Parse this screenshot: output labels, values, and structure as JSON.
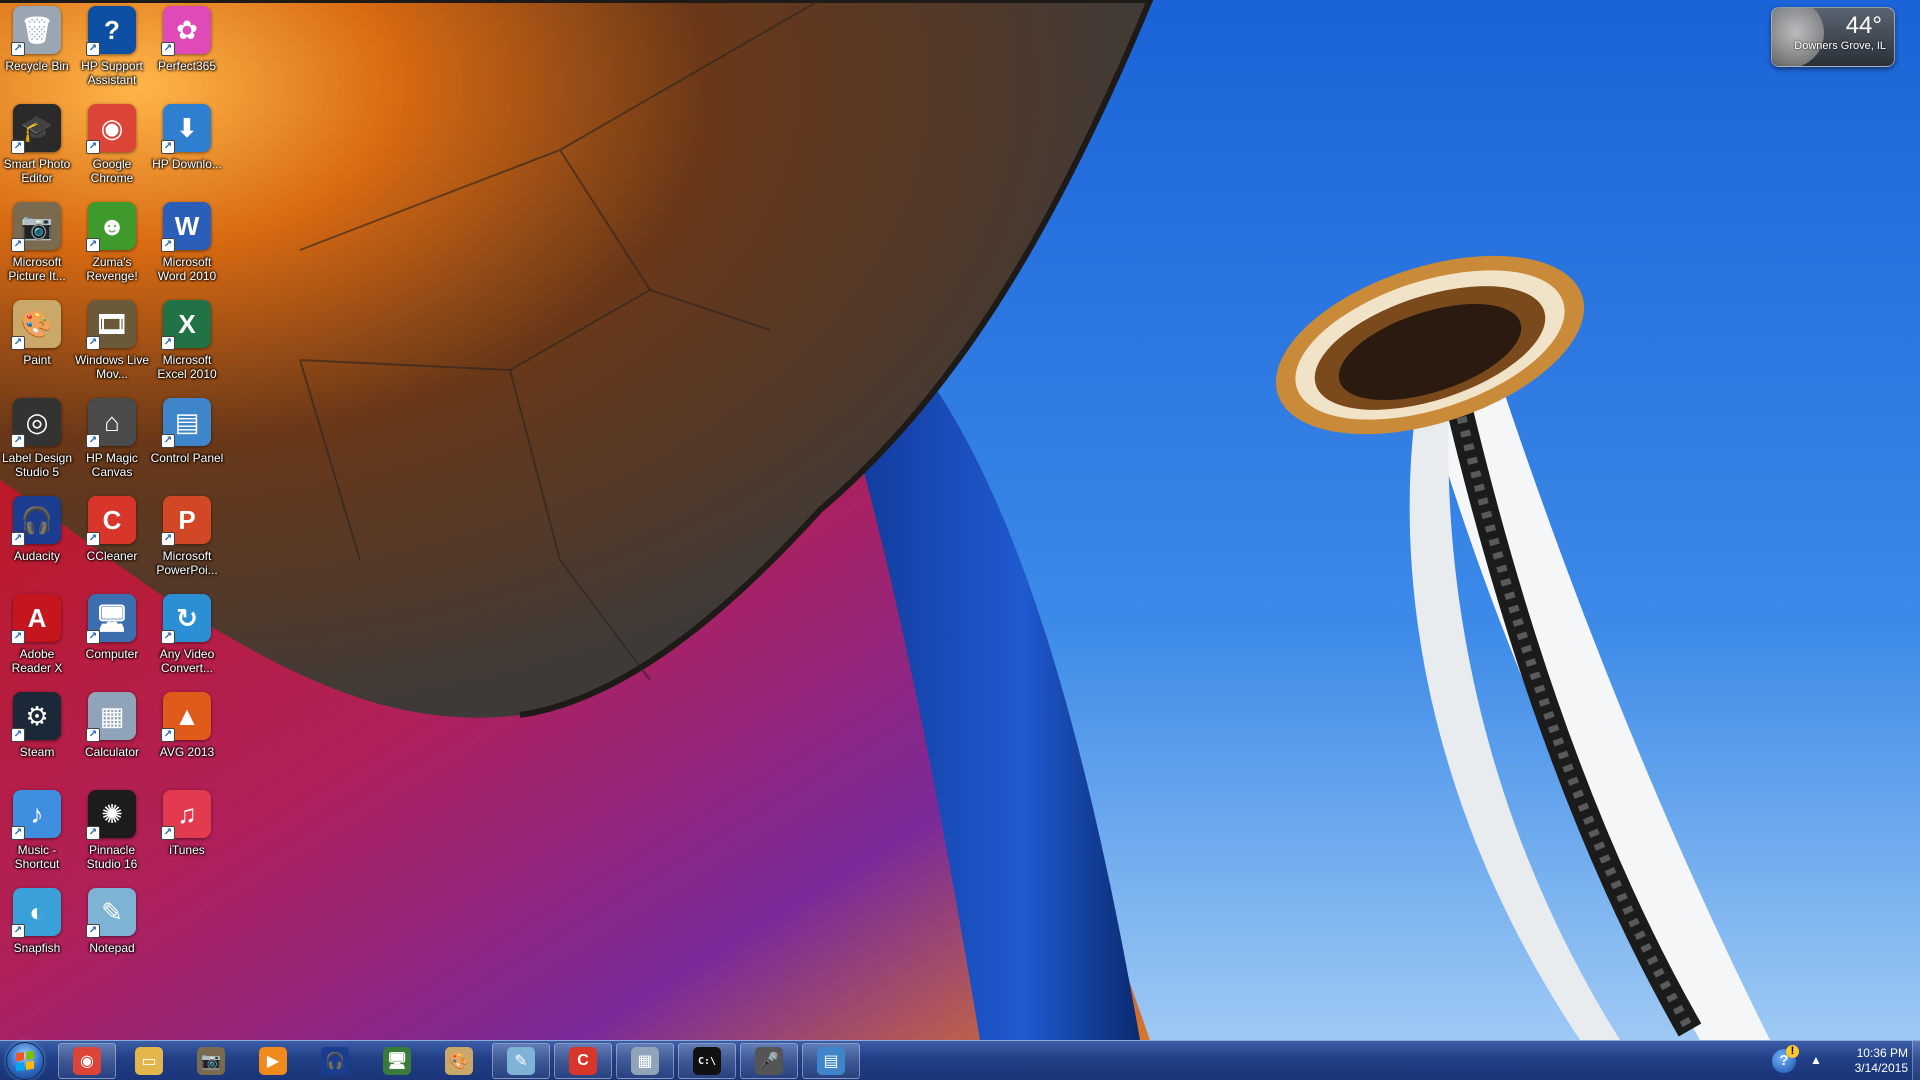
{
  "desktop": {
    "icons": [
      {
        "label": "Recycle Bin",
        "icon": "recycle-bin-icon",
        "glyph": "🗑",
        "color": "#9aa7b2"
      },
      {
        "label": "HP Support Assistant",
        "icon": "hp-support-icon",
        "glyph": "?",
        "color": "#0d4fa3"
      },
      {
        "label": "Perfect365",
        "icon": "perfect365-icon",
        "glyph": "✿",
        "color": "#e04ab8"
      },
      {
        "label": "Smart Photo Editor",
        "icon": "graduation-cap-icon",
        "glyph": "🎓",
        "color": "#2a2a2a"
      },
      {
        "label": "Google Chrome",
        "icon": "chrome-icon",
        "glyph": "◉",
        "color": "#db4437"
      },
      {
        "label": "HP Downlo...",
        "icon": "hp-download-icon",
        "glyph": "⬇",
        "color": "#2f7fd1"
      },
      {
        "label": "Microsoft Picture It...",
        "icon": "camera-icon",
        "glyph": "📷",
        "color": "#7a6a50"
      },
      {
        "label": "Zuma's Revenge!",
        "icon": "zuma-frog-icon",
        "glyph": "☻",
        "color": "#3f9a2c"
      },
      {
        "label": "Microsoft Word 2010",
        "icon": "word-icon",
        "glyph": "W",
        "color": "#2b5eb8"
      },
      {
        "label": "Paint",
        "icon": "paint-palette-icon",
        "glyph": "🎨",
        "color": "#c9a86a"
      },
      {
        "label": "Windows Live Mov...",
        "icon": "movie-maker-icon",
        "glyph": "🎞",
        "color": "#6b5a3a"
      },
      {
        "label": "Microsoft Excel 2010",
        "icon": "excel-icon",
        "glyph": "X",
        "color": "#217346"
      },
      {
        "label": "Label Design Studio 5",
        "icon": "disc-icon",
        "glyph": "◎",
        "color": "#333333"
      },
      {
        "label": "HP Magic Canvas",
        "icon": "house-icon",
        "glyph": "⌂",
        "color": "#4b4b4b"
      },
      {
        "label": "Control Panel",
        "icon": "control-panel-icon",
        "glyph": "▤",
        "color": "#3e86c9"
      },
      {
        "label": "Audacity",
        "icon": "audacity-icon",
        "glyph": "🎧",
        "color": "#1b3d8f"
      },
      {
        "label": "CCleaner",
        "icon": "ccleaner-icon",
        "glyph": "C",
        "color": "#d8362a"
      },
      {
        "label": "Microsoft PowerPoi...",
        "icon": "powerpoint-icon",
        "glyph": "P",
        "color": "#d24726"
      },
      {
        "label": "Adobe Reader X",
        "icon": "adobe-reader-icon",
        "glyph": "A",
        "color": "#c4161c"
      },
      {
        "label": "Computer",
        "icon": "computer-icon",
        "glyph": "🖥",
        "color": "#3d6fb0"
      },
      {
        "label": "Any Video Convert...",
        "icon": "video-converter-icon",
        "glyph": "↻",
        "color": "#2b8fd6"
      },
      {
        "label": "Steam",
        "icon": "steam-icon",
        "glyph": "⚙",
        "color": "#1b2838"
      },
      {
        "label": "Calculator",
        "icon": "calculator-icon",
        "glyph": "▦",
        "color": "#8fa4b8"
      },
      {
        "label": "AVG 2013",
        "icon": "avg-icon",
        "glyph": "▲",
        "color": "#e05a1a"
      },
      {
        "label": "Music - Shortcut",
        "icon": "music-note-icon",
        "glyph": "♪",
        "color": "#3f8fe0"
      },
      {
        "label": "Pinnacle Studio 16",
        "icon": "pinnacle-icon",
        "glyph": "✺",
        "color": "#1c1c1c"
      },
      {
        "label": "iTunes",
        "icon": "itunes-icon",
        "glyph": "♫",
        "color": "#e23a4f"
      },
      {
        "label": "Snapfish",
        "icon": "snapfish-icon",
        "glyph": "◐",
        "color": "#3aa0d8"
      },
      {
        "label": "Notepad",
        "icon": "notepad-icon",
        "glyph": "✎",
        "color": "#7fb3d5"
      }
    ]
  },
  "weather": {
    "temperature": "44°",
    "location": "Downers Grove, IL"
  },
  "taskbar": {
    "items": [
      {
        "name": "chrome",
        "icon": "chrome-icon",
        "glyph": "◉",
        "color": "#db4437",
        "open": true
      },
      {
        "name": "explorer",
        "icon": "folder-icon",
        "glyph": "▭",
        "color": "#e3b64b",
        "open": false
      },
      {
        "name": "picture-it",
        "icon": "camera-icon",
        "glyph": "📷",
        "color": "#7a6a50",
        "open": false
      },
      {
        "name": "media-player",
        "icon": "play-icon",
        "glyph": "▶",
        "color": "#f08a1c",
        "open": false
      },
      {
        "name": "audacity",
        "icon": "audacity-icon",
        "glyph": "🎧",
        "color": "#1b3d8f",
        "open": false
      },
      {
        "name": "system-monitor",
        "icon": "monitor-icon",
        "glyph": "🖥",
        "color": "#3a7a3a",
        "open": false
      },
      {
        "name": "paint",
        "icon": "paint-palette-icon",
        "glyph": "🎨",
        "color": "#c9a86a",
        "open": false
      },
      {
        "name": "notepad",
        "icon": "notepad-icon",
        "glyph": "✎",
        "color": "#7fb3d5",
        "open": true
      },
      {
        "name": "ccleaner",
        "icon": "ccleaner-icon",
        "glyph": "C",
        "color": "#d8362a",
        "open": true
      },
      {
        "name": "calculator",
        "icon": "calculator-icon",
        "glyph": "▦",
        "color": "#8fa4b8",
        "open": true
      },
      {
        "name": "command-prompt",
        "icon": "terminal-icon",
        "glyph": "C:\\",
        "color": "#111111",
        "open": true
      },
      {
        "name": "microphone",
        "icon": "microphone-icon",
        "glyph": "🎤",
        "color": "#555555",
        "open": true
      },
      {
        "name": "control-panel",
        "icon": "control-panel-icon",
        "glyph": "▤",
        "color": "#3e86c9",
        "open": true
      }
    ],
    "tray": {
      "help_glyph": "?",
      "warning_glyph": "!",
      "expand_glyph": "▲",
      "time": "10:36 PM",
      "date": "3/14/2015"
    }
  }
}
